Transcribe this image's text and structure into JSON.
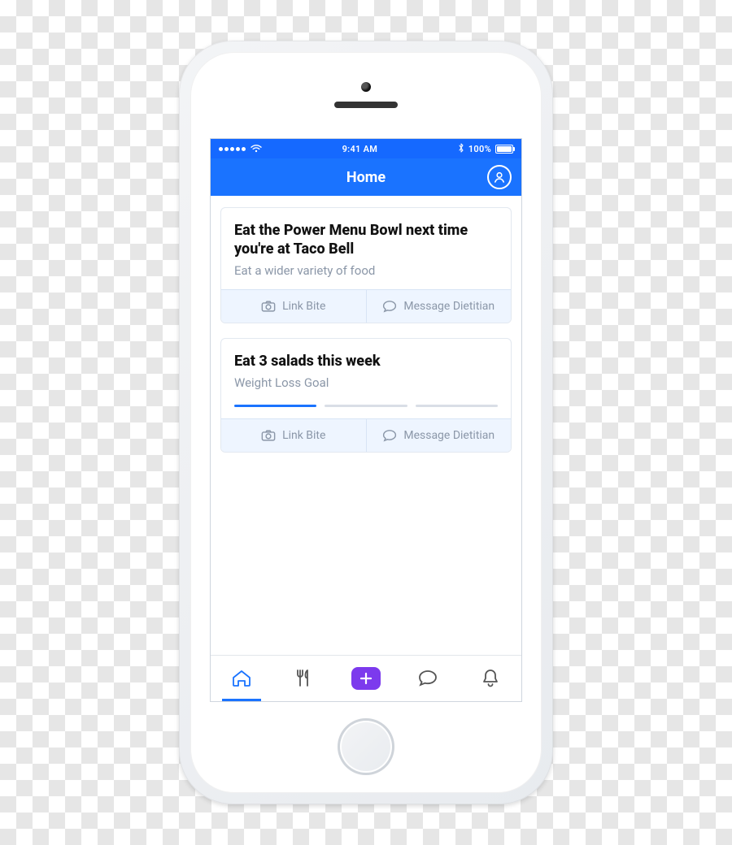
{
  "status": {
    "time": "9:41 AM",
    "battery_label": "100%",
    "bluetooth": true
  },
  "nav": {
    "title": "Home"
  },
  "cards": [
    {
      "title": "Eat the Power Menu Bowl next time you're at Taco Bell",
      "subtitle": "Eat a wider variety of food",
      "progress_segments": 0,
      "actions": {
        "link_bite": "Link Bite",
        "message_dietitian": "Message Dietitian"
      }
    },
    {
      "title": "Eat 3 salads this week",
      "subtitle": "Weight Loss Goal",
      "progress_segments": 3,
      "progress_completed": 1,
      "actions": {
        "link_bite": "Link Bite",
        "message_dietitian": "Message Dietitian"
      }
    }
  ],
  "tabs": {
    "home": "Home",
    "meals": "Meals",
    "add": "Add",
    "messages": "Messages",
    "notifications": "Notifications"
  },
  "colors": {
    "primary": "#1a73ff",
    "accent": "#7c3aed"
  }
}
